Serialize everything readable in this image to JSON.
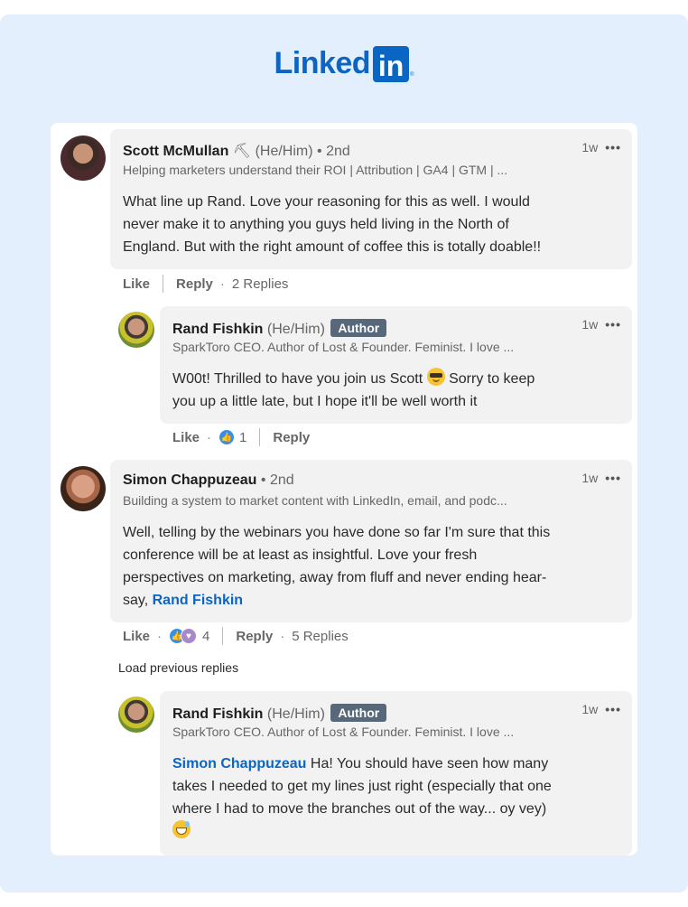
{
  "logo": {
    "text": "Linked",
    "box": "in",
    "registered": "®"
  },
  "comments": [
    {
      "author": "Scott McMullan",
      "emoji_after_name": "⛏",
      "pronouns": "(He/Him)",
      "degree": "• 2nd",
      "headline": "Helping marketers understand their ROI | Attribution | GA4 | GTM | ...",
      "time": "1w",
      "more": "•••",
      "body": [
        "What line up Rand. Love your reasoning for this as well. I would",
        "never make it to anything you guys held living in the North of",
        "England. But with the right amount of coffee this is totally doable!!"
      ],
      "actions": {
        "like": "Like",
        "reply": "Reply",
        "replies": "2 Replies"
      }
    },
    {
      "author": "Rand Fishkin",
      "pronouns": "(He/Him)",
      "badge": "Author",
      "headline": "SparkToro CEO. Author of Lost & Founder. Feminist. I love ...",
      "time": "1w",
      "more": "•••",
      "body_line1": "W00t! Thrilled to have you join us Scott",
      "body_line1b": " Sorry to keep",
      "body_line2": "you up a little late, but I hope it'll be well worth it",
      "emoji": "smiling-face-with-sunglasses",
      "actions": {
        "like": "Like",
        "reaction_count": "1",
        "reply": "Reply"
      }
    },
    {
      "author": "Simon Chappuzeau",
      "degree": "• 2nd",
      "headline": "Building a system to market content with LinkedIn, email, and podc...",
      "time": "1w",
      "more": "•••",
      "body": [
        "Well, telling by the webinars you have done so far I'm sure that this",
        "conference will be at least as insightful. Love your fresh",
        "perspectives on marketing, away from fluff and never ending hear-"
      ],
      "body_last_prefix": "say, ",
      "mention": "Rand Fishkin",
      "actions": {
        "like": "Like",
        "reaction_count": "4",
        "reply": "Reply",
        "replies": "5 Replies"
      }
    },
    {
      "author": "Rand Fishkin",
      "pronouns": "(He/Him)",
      "badge": "Author",
      "headline": "SparkToro CEO. Author of Lost & Founder. Feminist. I love ...",
      "time": "1w",
      "more": "•••",
      "mention": "Simon Chappuzeau",
      "body_first_rest": " Ha! You should have seen how many",
      "body": [
        "takes I needed to get my lines just right (especially that one",
        "where I had to move the branches out of the way... oy vey)"
      ],
      "emoji": "grinning-face-with-sweat"
    }
  ],
  "load_previous": "Load previous replies",
  "colors": {
    "brand": "#0a66c2",
    "background": "#e3effd",
    "bubble": "#f2f2f2",
    "badge": "#56687a"
  }
}
